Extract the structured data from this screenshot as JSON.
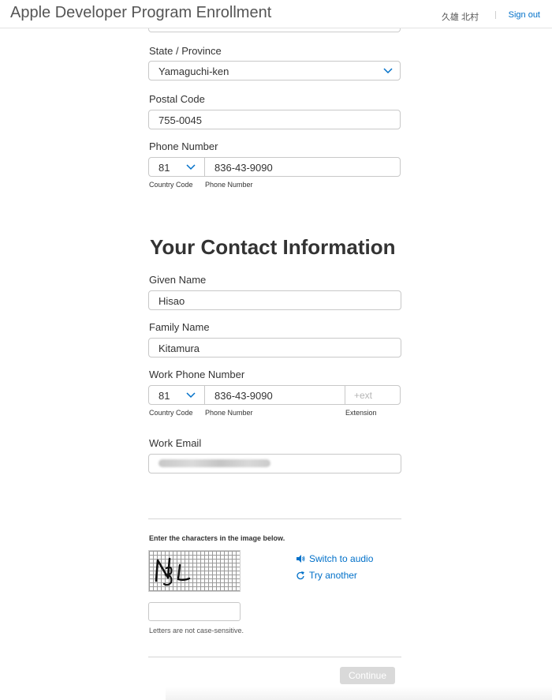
{
  "header": {
    "title": "Apple Developer Program Enrollment",
    "user_name": "久雄 北村",
    "sign_out_label": "Sign out"
  },
  "address": {
    "state_label": "State / Province",
    "state_value": "Yamaguchi-ken",
    "postal_label": "Postal Code",
    "postal_value": "755-0045",
    "phone_label": "Phone Number",
    "phone_country_code": "81",
    "phone_number": "836-43-9090",
    "country_code_caption": "Country Code",
    "phone_number_caption": "Phone Number"
  },
  "contact": {
    "section_title": "Your Contact Information",
    "given_name_label": "Given Name",
    "given_name_value": "Hisao",
    "family_name_label": "Family Name",
    "family_name_value": "Kitamura",
    "work_phone_label": "Work Phone Number",
    "work_phone_country_code": "81",
    "work_phone_number": "836-43-9090",
    "extension_placeholder": "+ext",
    "country_code_caption": "Country Code",
    "phone_number_caption": "Phone Number",
    "extension_caption": "Extension",
    "work_email_label": "Work Email"
  },
  "captcha": {
    "prompt": "Enter the characters in the image below.",
    "image_text": "NBL",
    "switch_audio_label": "Switch to audio",
    "try_another_label": "Try another",
    "case_note": "Letters are not case-sensitive."
  },
  "footer": {
    "continue_label": "Continue"
  },
  "colors": {
    "accent": "#0070c9",
    "disabled_button": "#d9d9d9",
    "border": "#c8c8c8"
  }
}
